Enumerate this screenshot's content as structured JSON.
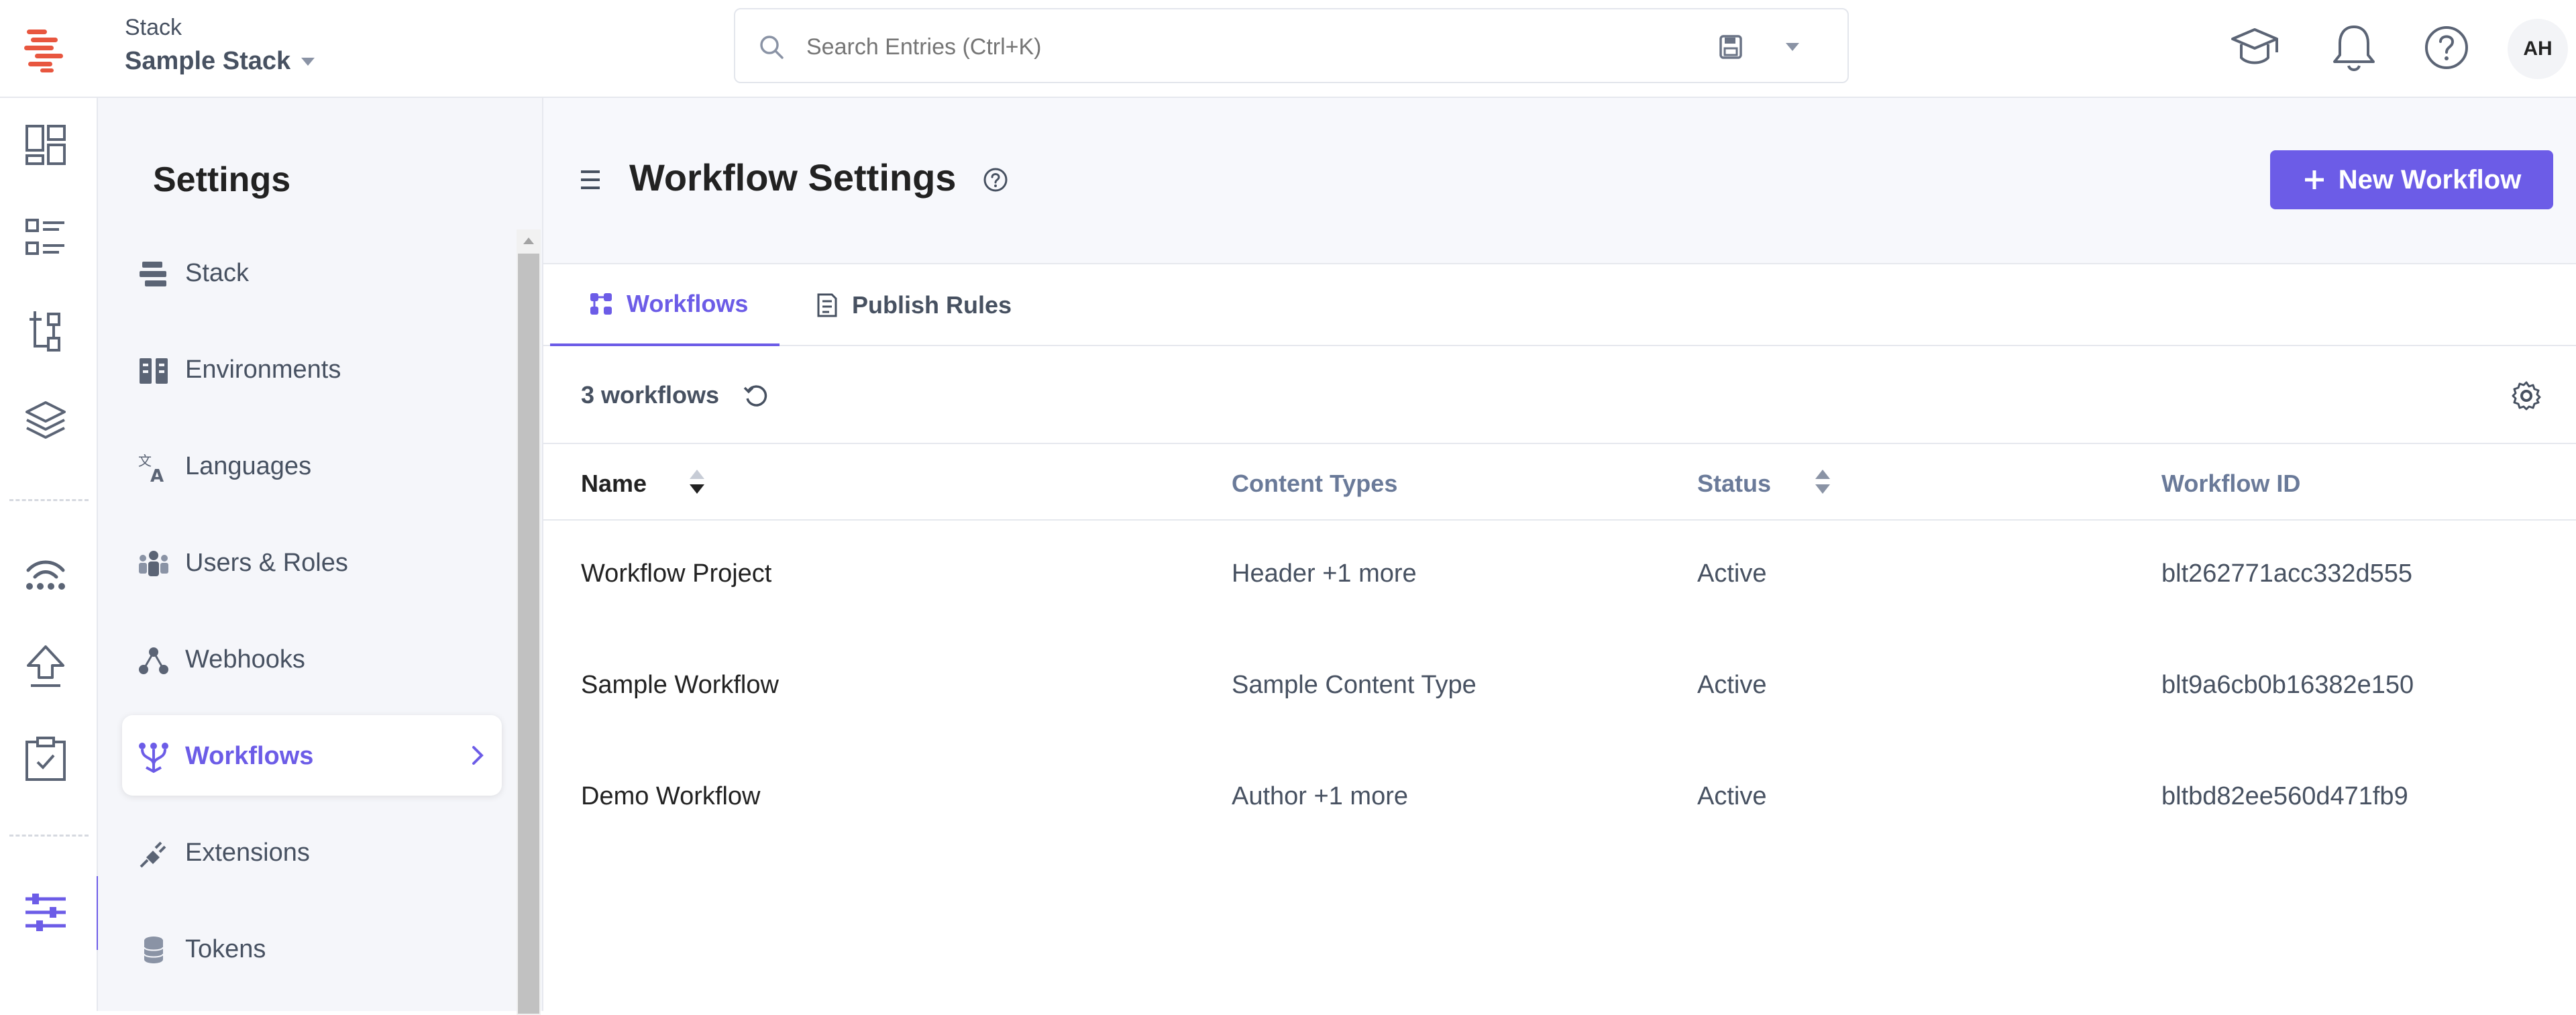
{
  "header": {
    "stack_label": "Stack",
    "stack_name": "Sample Stack",
    "search_placeholder": "Search Entries (Ctrl+K)",
    "avatar_initials": "AH",
    "icons": [
      "academy-icon",
      "bell-icon",
      "help-icon"
    ]
  },
  "rail": {
    "icons": [
      "dashboard-icon",
      "entries-icon",
      "content-models-icon",
      "assets-layers-icon",
      "automation-icon",
      "deploy-icon",
      "tasks-icon",
      "settings-sliders-icon"
    ]
  },
  "settings": {
    "title": "Settings",
    "items": [
      {
        "label": "Stack",
        "icon": "stack-icon"
      },
      {
        "label": "Environments",
        "icon": "environments-icon"
      },
      {
        "label": "Languages",
        "icon": "languages-icon"
      },
      {
        "label": "Users & Roles",
        "icon": "users-roles-icon"
      },
      {
        "label": "Webhooks",
        "icon": "webhooks-icon"
      },
      {
        "label": "Workflows",
        "icon": "workflows-icon",
        "active": true
      },
      {
        "label": "Extensions",
        "icon": "extensions-icon"
      },
      {
        "label": "Tokens",
        "icon": "tokens-icon"
      }
    ]
  },
  "main": {
    "title": "Workflow Settings",
    "new_button": "New Workflow",
    "tabs": [
      {
        "label": "Workflows",
        "active": true
      },
      {
        "label": "Publish Rules",
        "active": false
      }
    ],
    "count": "3 workflows",
    "columns": [
      "Name",
      "Content Types",
      "Status",
      "Workflow ID"
    ],
    "rows": [
      {
        "name": "Workflow Project",
        "content_types": "Header",
        "more": "+1 more",
        "status": "Active",
        "id": "blt262771acc332d555"
      },
      {
        "name": "Sample Workflow",
        "content_types": "Sample Content Type",
        "more": "",
        "status": "Active",
        "id": "blt9a6cb0b16382e150"
      },
      {
        "name": "Demo Workflow",
        "content_types": "Author",
        "more": "+1 more",
        "status": "Active",
        "id": "bltbd82ee560d471fb9"
      }
    ]
  },
  "colors": {
    "accent": "#6c5ce7",
    "logo": "#e8563f",
    "text": "#222222",
    "muted": "#475161",
    "header_col": "#6a7a99"
  }
}
